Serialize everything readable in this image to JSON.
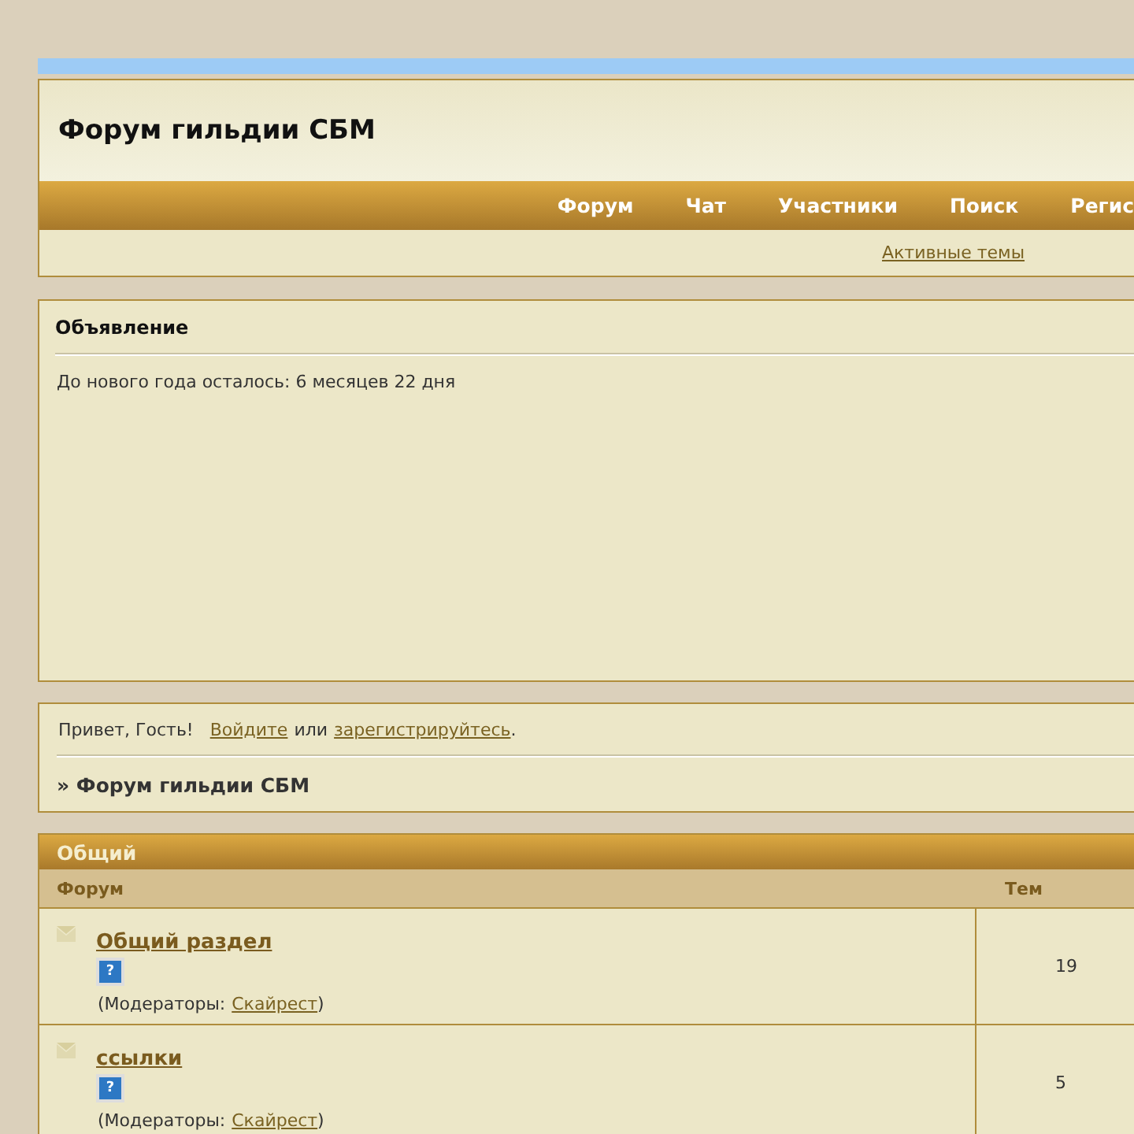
{
  "header": {
    "title": "Форум гильдии СБМ"
  },
  "nav": [
    "Форум",
    "Чат",
    "Участники",
    "Поиск",
    "Регис"
  ],
  "subnav": {
    "link": "Активные темы"
  },
  "announcement": {
    "title": "Объявление",
    "text": "До нового года осталось: 6 месяцев 22 дня"
  },
  "greeting": {
    "text": "Привет, Гость!",
    "login": "Войдите",
    "or": "или",
    "register": "зарегистрируйтесь",
    "end": "."
  },
  "breadcrumb": "» Форум гильдии СБМ",
  "category": {
    "title": "Общий",
    "columns": [
      "Форум",
      "Тем"
    ],
    "rows": [
      {
        "name": "Общий раздел",
        "icon_char": "?",
        "moderators_label": "(Модераторы:",
        "moderator": "Скайрест",
        "close": ")",
        "topics": "19"
      },
      {
        "name": "ссылки",
        "icon_char": "?",
        "moderators_label": "(Модераторы:",
        "moderator": "Скайрест",
        "close": ")",
        "topics": "5"
      }
    ]
  }
}
